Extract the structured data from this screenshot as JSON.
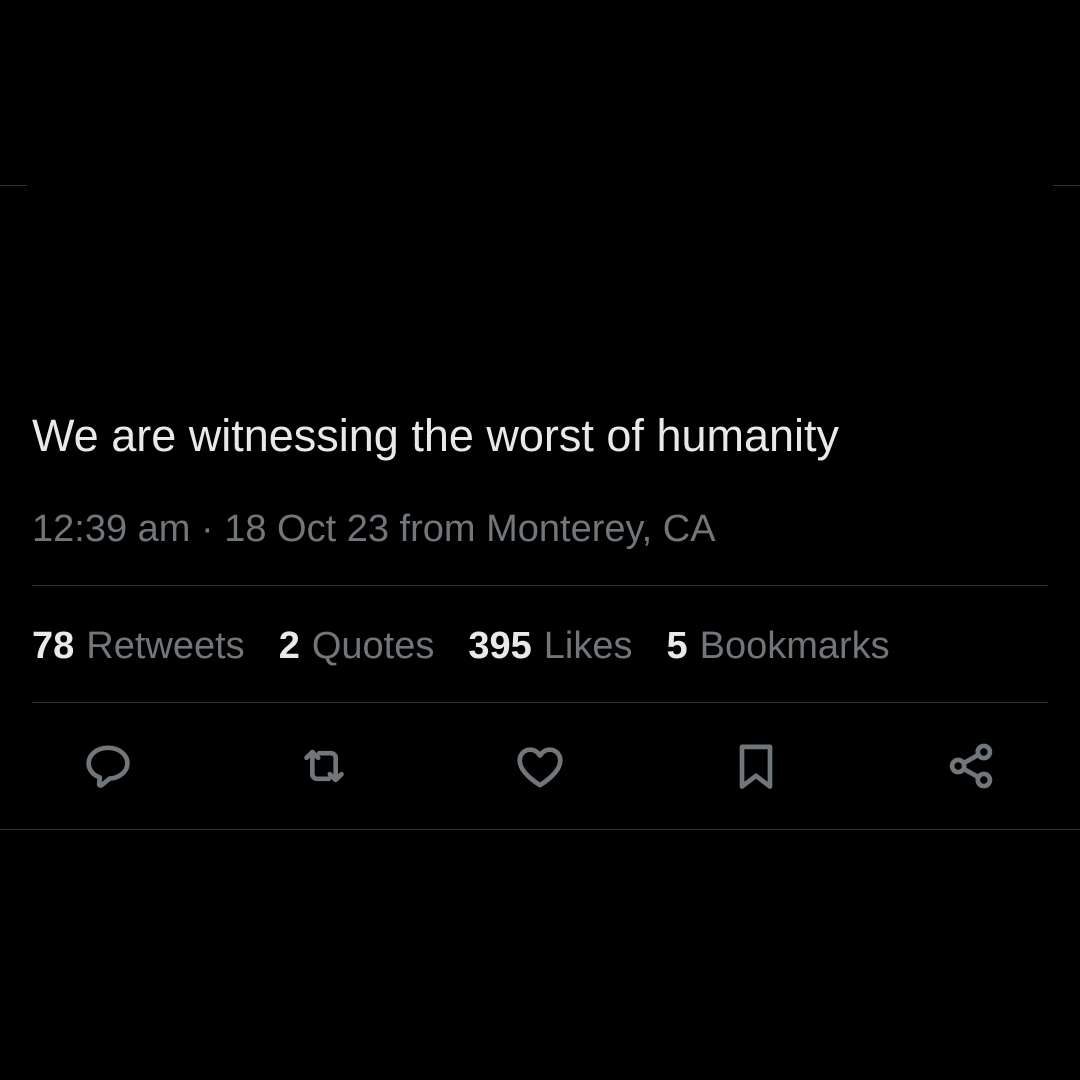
{
  "tweet": {
    "text": "We are witnessing the worst of humanity",
    "meta": "12:39 am · 18 Oct 23 from Monterey, CA"
  },
  "stats": [
    {
      "count": "78",
      "label": "Retweets"
    },
    {
      "count": "2",
      "label": "Quotes"
    },
    {
      "count": "395",
      "label": "Likes"
    },
    {
      "count": "5",
      "label": "Bookmarks"
    }
  ],
  "actions": {
    "reply_icon": "speech-bubble-icon",
    "retweet_icon": "retweet-arrows-icon",
    "like_icon": "heart-icon",
    "bookmark_icon": "bookmark-icon",
    "share_icon": "share-nodes-icon"
  },
  "colors": {
    "background": "#000000",
    "text_primary": "#e7e9ea",
    "text_secondary": "#71767b",
    "divider": "#2f3336"
  }
}
